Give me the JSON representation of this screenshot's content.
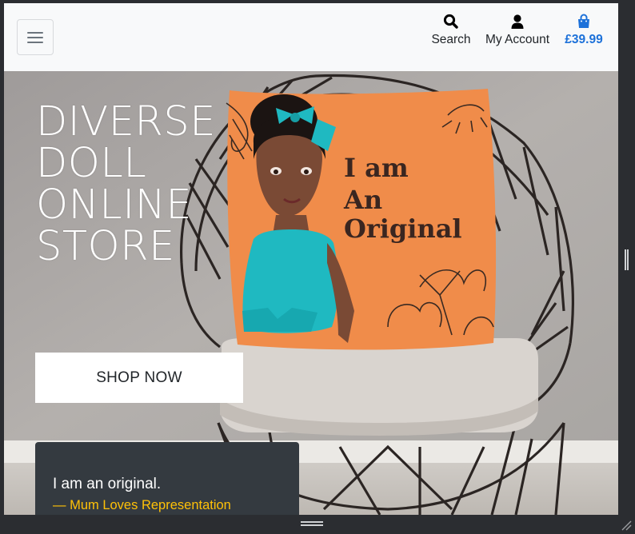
{
  "nav": {
    "search_label": "Search",
    "account_label": "My Account",
    "bag_total": "£39.99",
    "icons": {
      "menu": "hamburger-icon",
      "search": "search-icon",
      "account": "user-icon",
      "bag": "shopping-bag-icon"
    },
    "colors": {
      "bag": "#1d71d9",
      "navbar_bg": "#f8f9fa"
    }
  },
  "hero": {
    "title_lines": [
      "DIVERSE",
      "DOLL",
      "ONLINE",
      "STORE"
    ],
    "cta_label": "SHOP NOW",
    "pillow_text": [
      "I am",
      "An",
      "Original"
    ],
    "pillow_color": "#f08c4a",
    "accent_color": "#1fb9c1"
  },
  "testimonial": {
    "quote": "I am an original.",
    "author": "— Mum Loves Representation",
    "colors": {
      "card_bg": "#343a40",
      "author": "#ffc107"
    }
  }
}
